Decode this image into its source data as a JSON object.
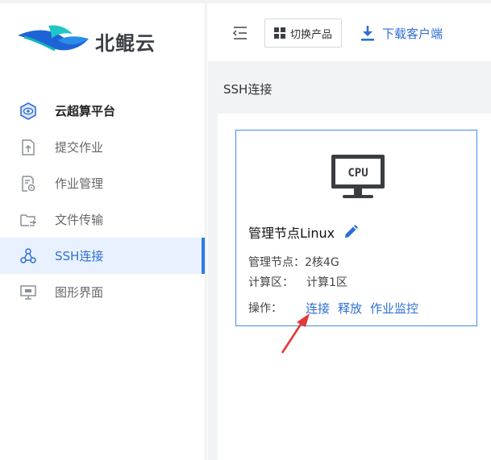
{
  "brand": {
    "name": "北鲲云"
  },
  "sidebar": {
    "items": [
      {
        "label": "云超算平台",
        "icon": "eye-shield-icon"
      },
      {
        "label": "提交作业",
        "icon": "upload-doc-icon"
      },
      {
        "label": "作业管理",
        "icon": "doc-settings-icon"
      },
      {
        "label": "文件传输",
        "icon": "folder-transfer-icon"
      },
      {
        "label": "SSH连接",
        "icon": "network-nodes-icon",
        "active": true
      },
      {
        "label": "图形界面",
        "icon": "monitor-icon"
      }
    ]
  },
  "header": {
    "switch_product_label": "切换产品",
    "download_client_label": "下载客户端"
  },
  "page": {
    "title": "SSH连接"
  },
  "card": {
    "cpu_label": "CPU",
    "title": "管理节点Linux",
    "fields": [
      {
        "key": "管理节点：",
        "value": "2核4G"
      },
      {
        "key": "计算区：",
        "value": "计算1区"
      }
    ],
    "ops_label": "操作：",
    "actions": [
      "连接",
      "释放",
      "作业监控"
    ]
  },
  "colors": {
    "accent": "#2f6ed6",
    "active_bg": "#e8f1fd",
    "card_border": "#3f8cf0",
    "arrow": "#e53935"
  }
}
